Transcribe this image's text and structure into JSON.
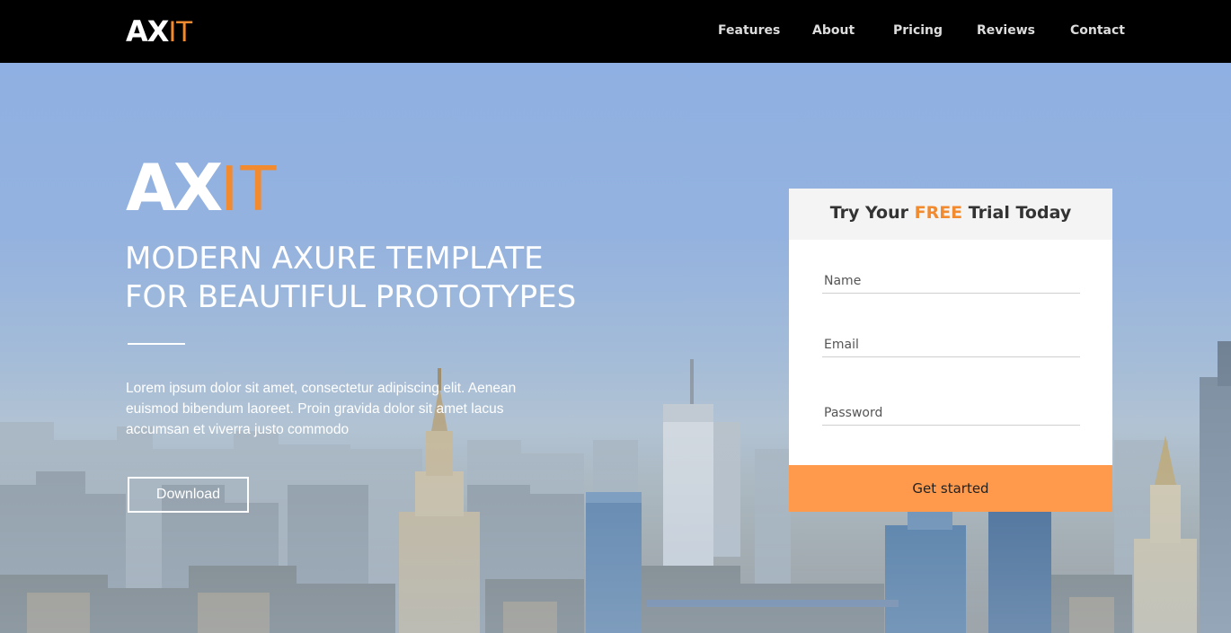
{
  "brand": {
    "logo_main": "AX",
    "logo_accent": "IT"
  },
  "nav": {
    "items": [
      {
        "label": "Features"
      },
      {
        "label": "About"
      },
      {
        "label": "Pricing"
      },
      {
        "label": "Reviews"
      },
      {
        "label": "Contact"
      }
    ]
  },
  "hero": {
    "logo_main": "AX",
    "logo_accent": "IT",
    "headline_line1": "MODERN AXURE TEMPLATE",
    "headline_line2": "FOR BEAUTIFUL PROTOTYPES",
    "body": "Lorem ipsum dolor sit amet, consectetur adipiscing elit. Aenean euismod bibendum laoreet. Proin gravida dolor sit amet lacus accumsan et viverra justo commodo",
    "download_label": "Download"
  },
  "signup": {
    "title_before": "Try Your ",
    "title_accent": "FREE",
    "title_after": " Trial Today",
    "name_placeholder": "Name",
    "email_placeholder": "Email",
    "password_placeholder": "Password",
    "submit_label": "Get started"
  },
  "colors": {
    "accent": "#f28a30",
    "button": "#ff9a4d",
    "navbar": "#000000"
  }
}
